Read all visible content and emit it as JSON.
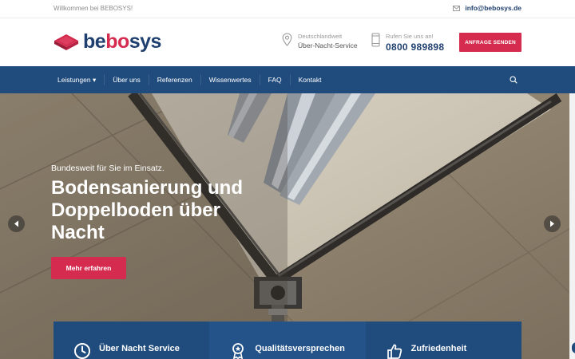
{
  "topbar": {
    "welcome": "Willkommen bei BEBOSYS!",
    "email": "info@bebosys.de"
  },
  "header": {
    "logo_prefix": "be",
    "logo_mid": "bo",
    "logo_suffix": "sys",
    "location_label": "Deutschlandweit",
    "location_value": "Über-Nacht-Service",
    "phone_label": "Rufen Sie uns an!",
    "phone_value": "0800 989898",
    "cta_label": "ANFRAGE SENDEN"
  },
  "nav": {
    "items": [
      {
        "label": "Leistungen ▾"
      },
      {
        "label": "Über uns"
      },
      {
        "label": "Referenzen"
      },
      {
        "label": "Wissenwertes"
      },
      {
        "label": "FAQ"
      },
      {
        "label": "Kontakt"
      }
    ]
  },
  "hero": {
    "tagline": "Bundesweit für Sie im Einsatz.",
    "headline": "Bodensanierung und Doppelboden über Nacht",
    "button_label": "Mehr erfahren"
  },
  "features": [
    {
      "title": "Über Nacht Service",
      "icon": "clock-icon"
    },
    {
      "title": "Qualitätsversprechen",
      "icon": "award-icon"
    },
    {
      "title": "Zufriedenheit",
      "icon": "thumbs-up-icon"
    }
  ],
  "colors": {
    "brand_blue": "#1f4b7d",
    "brand_red": "#d42b4f"
  }
}
